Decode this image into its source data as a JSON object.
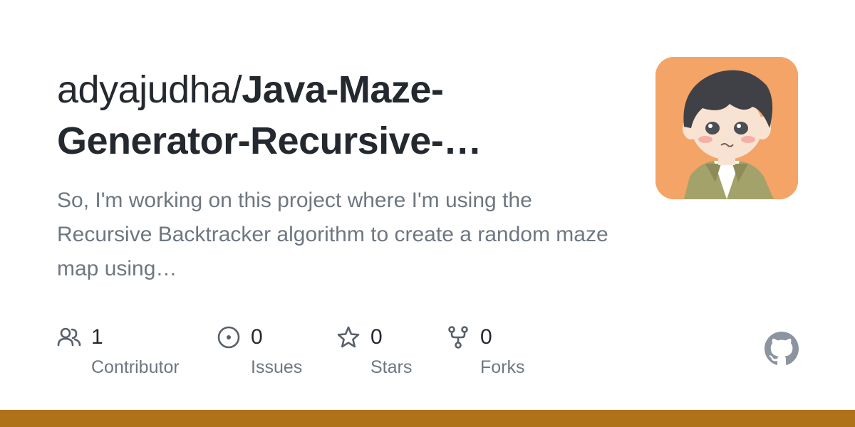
{
  "repo": {
    "owner_prefix": "adyajudha/",
    "name": "Java-Maze-Generator-Recursive-…",
    "description": "So, I'm working on this project where I'm using the Recursive Backtracker algorithm to create a random maze map using…"
  },
  "avatar": {
    "alt": "avatar",
    "background_color": "#f3a466"
  },
  "stats": [
    {
      "icon": "people-icon",
      "count": "1",
      "label": "Contributor"
    },
    {
      "icon": "issue-opened-icon",
      "count": "0",
      "label": "Issues"
    },
    {
      "icon": "star-icon",
      "count": "0",
      "label": "Stars"
    },
    {
      "icon": "repo-forked-icon",
      "count": "0",
      "label": "Forks"
    }
  ],
  "colors": {
    "title": "#24292f",
    "muted": "#6e7781",
    "icon": "#57606a",
    "github_logo": "#8c959f",
    "language_bar": "#b07219"
  }
}
